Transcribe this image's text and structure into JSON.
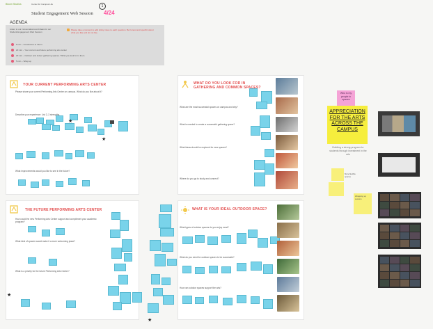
{
  "header": {
    "org_label": "Bloom Studios",
    "line1": "Center for Campus Life",
    "line2": "Student Engagement Web Session",
    "title": "Student Engagement Web Session",
    "badge": "4/24",
    "note": "1"
  },
  "agenda": {
    "title": "AGENDA",
    "intro": "Listen to our conversations and ideas for our Student Engagement Web Session",
    "items": [
      "5 min – Introduction & Intent",
      "20 min – Your current and future performing arts center",
      "20 min – Outdoor and indoor gathering spaces / What you look for in them",
      "5 min – Wrap up"
    ],
    "callout": "Please take a moment to add sticky notes to each question. Be honest and specific about what you like and do not like."
  },
  "sections": {
    "current_pac": {
      "title": "YOUR CURRENT PERFORMING ARTS CENTER",
      "q1": "Please share your current Performing Arts Center on campus. What do you like about it?",
      "q2": "Describe your experience: List 2–3 strengths.",
      "q3": "What improvements would you like to see in the future?"
    },
    "gathering": {
      "title": "WHAT DO YOU LOOK FOR IN GATHERING AND COMMON SPACES?",
      "q1": "What are the most successful spaces on campus and why?",
      "q2": "What is needed to create a successful gathering space?",
      "q3": "What ideas should be explored for new spaces?",
      "q4": "Where do you go to study and connect?"
    },
    "future_pac": {
      "title": "THE FUTURE PERFORMING ARTS CENTER",
      "q1": "How could the new Performing Arts Center support and compliment your academic program?",
      "q2": "What kind of spaces would make it a more welcoming place?",
      "q3": "What is a priority for the future Performing Arts Center?"
    },
    "outdoor": {
      "title": "WHAT IS YOUR IDEAL OUTDOOR SPACE?",
      "q1": "What types of outdoor spaces do you enjoy most?",
      "q2": "What do you need for outdoor spaces to be successful?",
      "q3": "How can outdoor spaces support the arts?"
    }
  },
  "right_column": {
    "pink_note": "Who is my people in spaces",
    "headline": "APPRECIATION FOR THE ARTS ACROSS THE CAMPUS",
    "yellow_caption": "Building a strong program for students through investment in the arts",
    "small_note": "More flexible spaces",
    "yellow_note": "Wrapping up session"
  },
  "colors": {
    "sticky_blue": "#79d3ea",
    "title_red": "#e24a4a",
    "headline_yellow": "#f6ee3d",
    "pink": "#ff4f9c",
    "icon_yellow": "#f2c94c"
  }
}
